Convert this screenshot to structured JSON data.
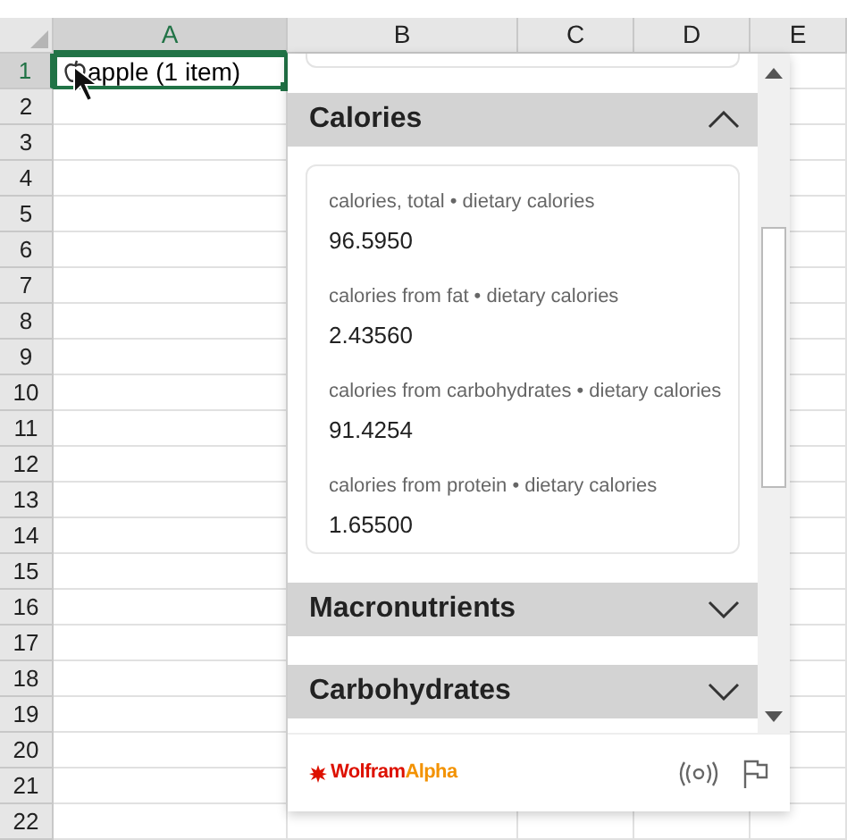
{
  "sheet": {
    "columns": [
      {
        "label": "A",
        "selected": true
      },
      {
        "label": "B",
        "selected": false
      },
      {
        "label": "C",
        "selected": false
      },
      {
        "label": "D",
        "selected": false
      },
      {
        "label": "E",
        "selected": false
      }
    ],
    "rows": [
      {
        "label": "1",
        "selected": true
      },
      {
        "label": "2",
        "selected": false
      },
      {
        "label": "3",
        "selected": false
      },
      {
        "label": "4",
        "selected": false
      },
      {
        "label": "5",
        "selected": false
      },
      {
        "label": "6",
        "selected": false
      },
      {
        "label": "7",
        "selected": false
      },
      {
        "label": "8",
        "selected": false
      },
      {
        "label": "9",
        "selected": false
      },
      {
        "label": "10",
        "selected": false
      },
      {
        "label": "11",
        "selected": false
      },
      {
        "label": "12",
        "selected": false
      },
      {
        "label": "13",
        "selected": false
      },
      {
        "label": "14",
        "selected": false
      },
      {
        "label": "15",
        "selected": false
      },
      {
        "label": "16",
        "selected": false
      },
      {
        "label": "17",
        "selected": false
      },
      {
        "label": "18",
        "selected": false
      },
      {
        "label": "19",
        "selected": false
      },
      {
        "label": "20",
        "selected": false
      },
      {
        "label": "21",
        "selected": false
      },
      {
        "label": "22",
        "selected": false
      }
    ],
    "active_cell": {
      "text": "apple (1 item)"
    }
  },
  "panel": {
    "sections": [
      {
        "title": "Calories",
        "expanded": true,
        "items": [
          {
            "label": "calories, total • dietary calories",
            "value": "96.5950"
          },
          {
            "label": "calories from fat • dietary calories",
            "value": "2.43560"
          },
          {
            "label": "calories from carbohydrates • dietary calories",
            "value": "91.4254"
          },
          {
            "label": "calories from protein • dietary calories",
            "value": "1.65500"
          }
        ]
      },
      {
        "title": "Macronutrients",
        "expanded": false
      },
      {
        "title": "Carbohydrates",
        "expanded": false
      }
    ],
    "footer": {
      "brand_main": "Wolfram",
      "brand_accent": "Alpha"
    }
  }
}
